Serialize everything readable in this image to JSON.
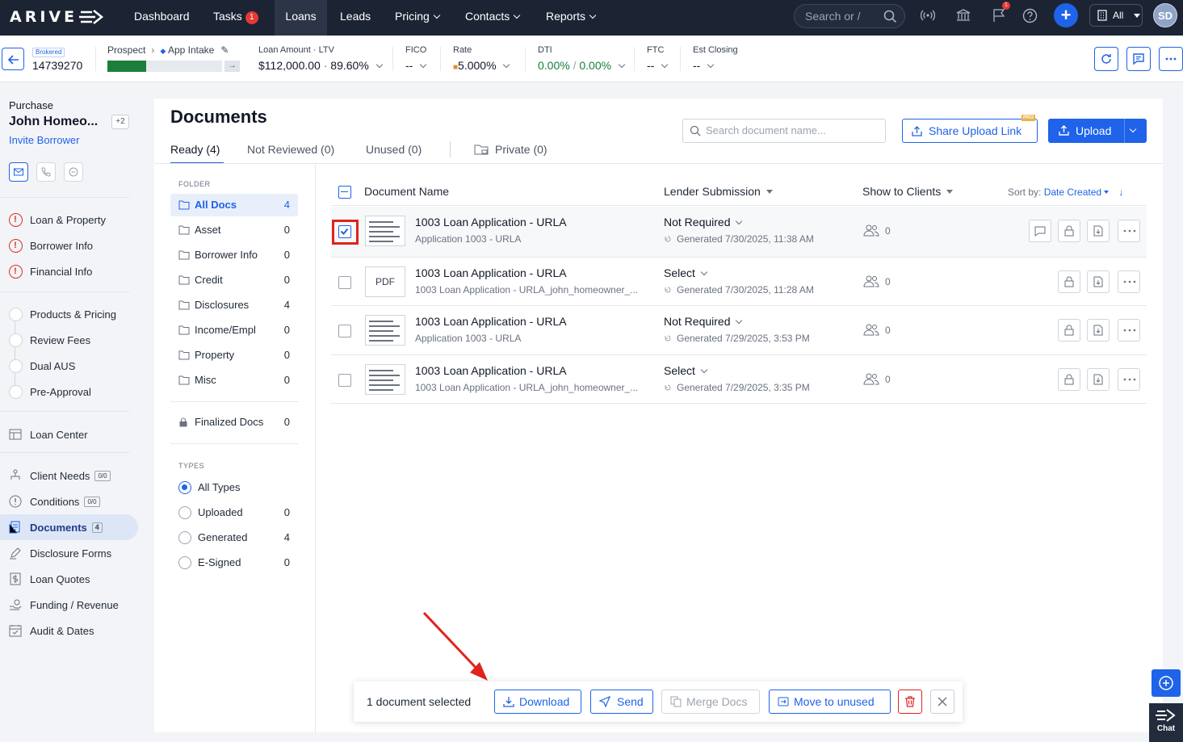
{
  "topnav": {
    "logo": "ARIVE",
    "items": [
      {
        "label": "Dashboard"
      },
      {
        "label": "Tasks",
        "count": "1"
      },
      {
        "label": "Loans"
      },
      {
        "label": "Leads"
      },
      {
        "label": "Pricing"
      },
      {
        "label": "Contacts"
      },
      {
        "label": "Reports"
      }
    ],
    "search_placeholder": "Search or /",
    "notification_count": "1",
    "all_label": "All",
    "avatar_initials": "SD"
  },
  "loanbar": {
    "brokered": "Brokered",
    "loan_number": "14739270",
    "stage": "Prospect",
    "substage": "App Intake",
    "progress_completed": 1,
    "progress_total": 3,
    "loan_amount_label": "Loan Amount · LTV",
    "loan_amount": "$112,000.00",
    "ltv": "89.60%",
    "fico_label": "FICO",
    "fico": "--",
    "rate_label": "Rate",
    "rate": "5.000%",
    "dti_label": "DTI",
    "dti_front": "0.00%",
    "dti_back": "0.00%",
    "ftc_label": "FTC",
    "ftc": "--",
    "closing_label": "Est Closing",
    "closing": "--"
  },
  "sidebar": {
    "loan_type": "Purchase",
    "borrower": "John Homeo...",
    "extra_borrowers": "+2",
    "invite": "Invite Borrower",
    "items": [
      {
        "label": "Loan & Property"
      },
      {
        "label": "Borrower Info"
      },
      {
        "label": "Financial Info"
      },
      {
        "label": "Products & Pricing"
      },
      {
        "label": "Review Fees"
      },
      {
        "label": "Dual AUS"
      },
      {
        "label": "Pre-Approval"
      },
      {
        "label": "Loan Center"
      },
      {
        "label": "Client Needs",
        "badge": "0/0"
      },
      {
        "label": "Conditions",
        "badge": "0/0"
      },
      {
        "label": "Documents",
        "badge": "4"
      },
      {
        "label": "Disclosure Forms"
      },
      {
        "label": "Loan Quotes"
      },
      {
        "label": "Funding / Revenue"
      },
      {
        "label": "Audit & Dates"
      }
    ]
  },
  "documents": {
    "title": "Documents",
    "tabs": [
      {
        "label": "Ready (4)"
      },
      {
        "label": "Not Reviewed (0)"
      },
      {
        "label": "Unused (0)"
      },
      {
        "label": "Private (0)"
      }
    ],
    "search_placeholder": "Search document name...",
    "share_label": "Share Upload Link",
    "pro": "PRO",
    "upload_label": "Upload",
    "folder_heading": "FOLDER",
    "folders": [
      {
        "label": "All Docs",
        "count": "4"
      },
      {
        "label": "Asset",
        "count": "0"
      },
      {
        "label": "Borrower Info",
        "count": "0"
      },
      {
        "label": "Credit",
        "count": "0"
      },
      {
        "label": "Disclosures",
        "count": "4"
      },
      {
        "label": "Income/Empl",
        "count": "0"
      },
      {
        "label": "Property",
        "count": "0"
      },
      {
        "label": "Misc",
        "count": "0"
      }
    ],
    "finalized": {
      "label": "Finalized Docs",
      "count": "0"
    },
    "types_heading": "TYPES",
    "types": [
      {
        "label": "All Types",
        "count": ""
      },
      {
        "label": "Uploaded",
        "count": "0"
      },
      {
        "label": "Generated",
        "count": "4"
      },
      {
        "label": "E-Signed",
        "count": "0"
      }
    ],
    "columns": {
      "name": "Document Name",
      "lender": "Lender Submission",
      "show": "Show to Clients",
      "sort_label": "Sort by:",
      "sort_value": "Date Created"
    },
    "rows": [
      {
        "name": "1003 Loan Application - URLA",
        "sub": "Application 1003 - URLA",
        "lender": "Not Required",
        "generated": "Generated 7/30/2025, 11:38 AM",
        "share_count": "0",
        "thumb": "image",
        "checked": true
      },
      {
        "name": "1003 Loan Application - URLA",
        "sub": "1003 Loan Application - URLA_john_homeowner_...",
        "lender": "Select",
        "generated": "Generated 7/30/2025, 11:28 AM",
        "share_count": "0",
        "thumb": "PDF",
        "checked": false
      },
      {
        "name": "1003 Loan Application - URLA",
        "sub": "Application 1003 - URLA",
        "lender": "Not Required",
        "generated": "Generated 7/29/2025, 3:53 PM",
        "share_count": "0",
        "thumb": "image",
        "checked": false
      },
      {
        "name": "1003 Loan Application - URLA",
        "sub": "1003 Loan Application - URLA_john_homeowner_...",
        "lender": "Select",
        "generated": "Generated 7/29/2025, 3:35 PM",
        "share_count": "0",
        "thumb": "image",
        "checked": false
      }
    ]
  },
  "bottombar": {
    "selected": "1 document selected",
    "download": "Download",
    "send": "Send",
    "merge": "Merge Docs",
    "move": "Move to unused"
  },
  "chat_label": "Chat",
  "colors": {
    "accent": "#1e63e9",
    "nav_bg": "#1c2434",
    "danger": "#e0231c",
    "success": "#17803d"
  }
}
